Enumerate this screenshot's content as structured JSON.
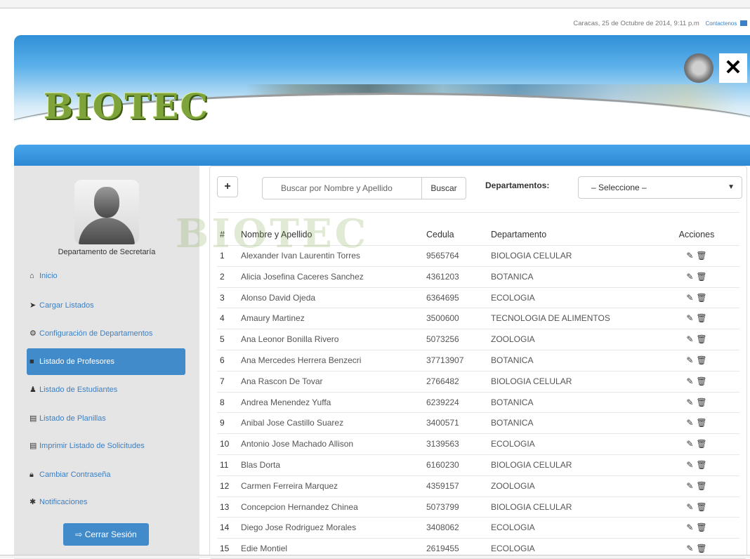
{
  "header": {
    "datetime": "Caracas, 25 de Octubre de 2014, 9:11 p.m",
    "contact": "Contactenos",
    "logo_text": "BIOTEC"
  },
  "sidebar": {
    "department": "Departamento de Secretaría",
    "items": [
      {
        "label": "Inicio",
        "icon": "home-icon"
      },
      {
        "label": "Cargar Listados",
        "icon": "send-icon"
      },
      {
        "label": "Configuración de Departamentos",
        "icon": "gear-icon"
      },
      {
        "label": "Listado de Profesores",
        "icon": "book-icon",
        "active": true
      },
      {
        "label": "Listado de Estudiantes",
        "icon": "user-icon"
      },
      {
        "label": "Listado de Planillas",
        "icon": "list-icon"
      },
      {
        "label": "Imprimir Listado de Solicitudes",
        "icon": "list-icon"
      },
      {
        "label": "Cambiar Contraseña",
        "icon": "lock-icon"
      },
      {
        "label": "Notificaciones",
        "icon": "asterisk-icon"
      }
    ],
    "logout": "Cerrar Sesión"
  },
  "toolbar": {
    "add": "+",
    "search_placeholder": "Buscar por Nombre y Apellido",
    "search_button": "Buscar",
    "departments_label": "Departamentos:",
    "departments_selected": "– Seleccione –"
  },
  "table": {
    "headers": [
      "#",
      "Nombre y Apellido",
      "Cedula",
      "Departamento",
      "Acciones"
    ],
    "rows": [
      [
        "1",
        "Alexander Ivan Laurentin Torres",
        "9565764",
        "BIOLOGIA CELULAR"
      ],
      [
        "2",
        "Alicia Josefina Caceres Sanchez",
        "4361203",
        "BOTANICA"
      ],
      [
        "3",
        "Alonso David Ojeda",
        "6364695",
        "ECOLOGIA"
      ],
      [
        "4",
        "Amaury Martinez",
        "3500600",
        "TECNOLOGIA DE ALIMENTOS"
      ],
      [
        "5",
        "Ana Leonor Bonilla Rivero",
        "5073256",
        "ZOOLOGIA"
      ],
      [
        "6",
        "Ana Mercedes Herrera Benzecri",
        "37713907",
        "BOTANICA"
      ],
      [
        "7",
        "Ana Rascon De Tovar",
        "2766482",
        "BIOLOGIA CELULAR"
      ],
      [
        "8",
        "Andrea Menendez Yuffa",
        "6239224",
        "BOTANICA"
      ],
      [
        "9",
        "Anibal Jose Castillo Suarez",
        "3400571",
        "BOTANICA"
      ],
      [
        "10",
        "Antonio Jose Machado Allison",
        "3139563",
        "ECOLOGIA"
      ],
      [
        "11",
        "Blas Dorta",
        "6160230",
        "BIOLOGIA CELULAR"
      ],
      [
        "12",
        "Carmen Ferreira Marquez",
        "4359157",
        "ZOOLOGIA"
      ],
      [
        "13",
        "Concepcion Hernandez Chinea",
        "5073799",
        "BIOLOGIA CELULAR"
      ],
      [
        "14",
        "Diego Jose Rodriguez Morales",
        "3408062",
        "ECOLOGIA"
      ],
      [
        "15",
        "Edie Montiel",
        "2619455",
        "ECOLOGIA"
      ]
    ]
  },
  "colors": {
    "primary": "#428bca",
    "banner": "#2e88d3",
    "sidebar_bg": "#e5e5e5"
  }
}
